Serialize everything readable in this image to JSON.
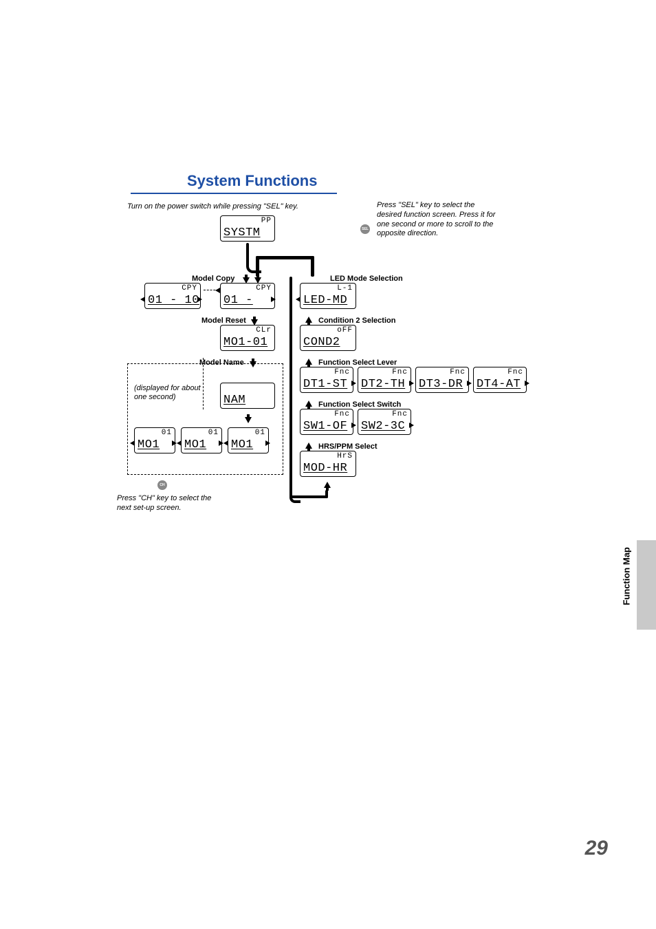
{
  "title": "System Functions",
  "note_top": "Turn on the power switch while pressing \"SEL\" key.",
  "note_sel": "Press \"SEL\" key to select the desired function screen. Press it for one second or more to scroll to the opposite direction.",
  "sel_label": "SEL",
  "ch_label": "CH",
  "note_ch": "Press \"CH\" key to select the next set-up screen.",
  "labels": {
    "model_copy": "Model Copy",
    "model_reset": "Model Reset",
    "model_name": "Model Name",
    "led": "LED Mode Selection",
    "cond2": "Condition 2 Selection",
    "fsl": "Function Select Lever",
    "fss": "Function Select Switch",
    "hrs": "HRS/PPM Select"
  },
  "disp_note": "(displayed for about one second)",
  "lcd": {
    "systm": {
      "top": "PP",
      "main": "SYSTM"
    },
    "cpy1": {
      "top": "CPY",
      "main": "01 - 10"
    },
    "cpy2": {
      "top": "CPY",
      "main": "01 -"
    },
    "reset": {
      "top": "CLr",
      "main": "MO1-01"
    },
    "nam": {
      "top": "",
      "main": "NAM"
    },
    "mo1a": {
      "top": "01",
      "main": "MO1"
    },
    "mo1b": {
      "top": "01",
      "main": "MO1"
    },
    "mo1c": {
      "top": "01",
      "main": "MO1"
    },
    "led": {
      "top": "L-1",
      "main": "LED-MD"
    },
    "cond2": {
      "top": "oFF",
      "main": "COND2"
    },
    "dt1": {
      "top": "Fnc",
      "main": "DT1-ST"
    },
    "dt2": {
      "top": "Fnc",
      "main": "DT2-TH"
    },
    "dt3": {
      "top": "Fnc",
      "main": "DT3-DR"
    },
    "dt4": {
      "top": "Fnc",
      "main": "DT4-AT"
    },
    "sw1": {
      "top": "Fnc",
      "main": "SW1-OF"
    },
    "sw2": {
      "top": "Fnc",
      "main": "SW2-3C"
    },
    "hrs": {
      "top": "HrS",
      "main": "MOD-HR"
    }
  },
  "side_tab": "Function Map",
  "page_num": "29"
}
